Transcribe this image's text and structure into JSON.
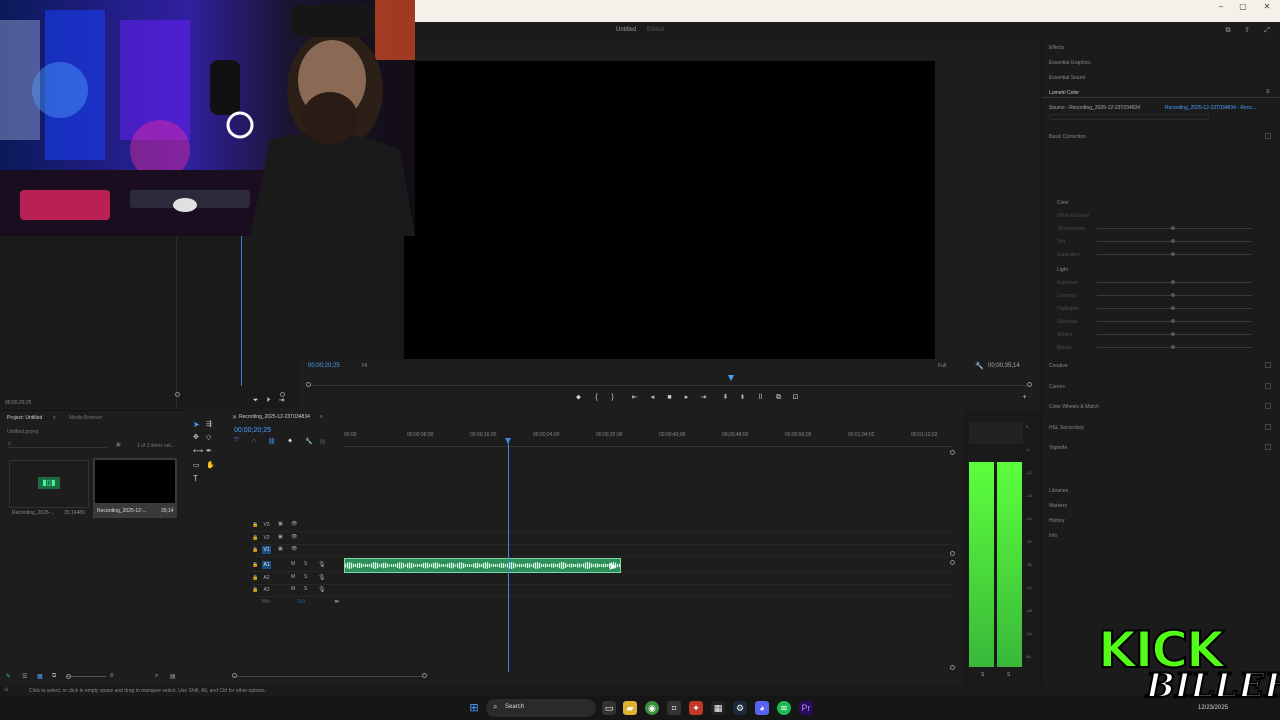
{
  "window": {
    "minimize": "–",
    "maximize": "▢",
    "close": "✕"
  },
  "header": {
    "doc_title": "Untitled",
    "doc_status": "Edited"
  },
  "program": {
    "timecode": "00;00;20;25",
    "fit_label": "Fit",
    "quality_label": "Full",
    "duration": "00;00;35;14"
  },
  "source": {
    "timecode": "00;00;20;25"
  },
  "right_panel": {
    "tabs": [
      "Effects",
      "Essential Graphics",
      "Essential Sound",
      "Lumetri Color"
    ],
    "source_label": "Source - Recording_2025-12-23T034834",
    "clip_label": "Recording_2025-12-23T034834 - Reco...",
    "sections_top": [
      "Basic Correction"
    ],
    "color_header": "Color",
    "color_rows": [
      "White Balance",
      "Temperature",
      "Tint",
      "Saturation"
    ],
    "light_header": "Light",
    "light_rows": [
      "Exposure",
      "Contrast",
      "Highlights",
      "Shadows",
      "Whites",
      "Blacks"
    ],
    "sections_bottom": [
      "Creative",
      "Curves",
      "Color Wheels & Match",
      "HSL Secondary",
      "Vignette"
    ],
    "panels": [
      "Libraries",
      "Markers",
      "History",
      "Info"
    ]
  },
  "project": {
    "tab_active": "Project: Untitled",
    "tab_other": "Media Browser",
    "file_name": "Untitled.prproj",
    "selection_info": "1 of 2 items sel...",
    "items": [
      {
        "name": "Recording_2025-...",
        "duration": "35;14480"
      },
      {
        "name": "Recording_2025-12-...",
        "duration": "35;14"
      }
    ]
  },
  "timeline": {
    "sequence_name": "Recording_2025-12-23T034834",
    "timecode": "00;00;20;25",
    "ruler": [
      "00;00",
      "00;00;08;00",
      "00;00;16;00",
      "00;00;24;00",
      "00;00;32;00",
      "00;00;40;00",
      "00;00;48;00",
      "00;00;56;00",
      "00;01;04;02",
      "00;01;12;02"
    ],
    "video_tracks": [
      "V3",
      "V2",
      "V1"
    ],
    "audio_tracks": [
      "A1",
      "A2",
      "A3"
    ],
    "mix_label": "Mix",
    "mix_value": "0.0",
    "playhead_fraction": 0.27,
    "clip_end_fraction": 0.46
  },
  "meter": {
    "labels": [
      "0",
      "-6",
      "-12",
      "-18",
      "-24",
      "-30",
      "-36",
      "-42",
      "-48",
      "-54",
      "dB"
    ],
    "bottom": [
      "S",
      "S"
    ]
  },
  "status_bar": {
    "hint": "Click to select, or click in empty space and drag to marquee select. Use Shift, Alt, and Ctrl for other options."
  },
  "taskbar": {
    "search_label": "Search",
    "clock": "12/23/2025"
  },
  "overlay": {
    "logo_line1": "KICK",
    "logo_line2": "BILLEH"
  },
  "colors": {
    "accent": "#4aa0ff",
    "clip_green": "#2f8f5a",
    "meter_green": "#39e639",
    "kick_green": "#53fc18"
  }
}
